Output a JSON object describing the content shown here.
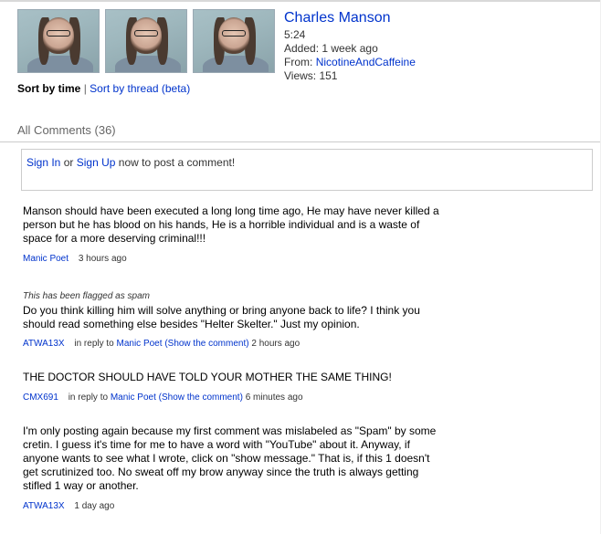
{
  "video": {
    "title": "Charles Manson",
    "duration": "5:24",
    "added": "Added: 1 week ago",
    "from_label": "From:",
    "from_user": "NicotineAndCaffeine",
    "views": "Views: 151",
    "thumbnails": [
      "thumbnail-1",
      "thumbnail-2",
      "thumbnail-3"
    ]
  },
  "sort": {
    "current": "Sort by time",
    "separator": "|",
    "other": "Sort by thread (beta)"
  },
  "comments_header": "All Comments (36)",
  "signin": {
    "sign_in": "Sign In",
    "or": "or",
    "sign_up": "Sign Up",
    "suffix": "now to post a comment!"
  },
  "comments": [
    {
      "flag": "",
      "body": "Manson should have been executed a long long time ago, He may have never killed a person but he has blood on his hands, He is a horrible individual and is a waste of space for a more deserving criminal!!!",
      "author": "Manic Poet",
      "in_reply_to_label": "",
      "in_reply_to_user": "",
      "show_comment": "",
      "time": "3 hours ago"
    },
    {
      "flag": "This has been flagged as spam",
      "body": "Do you think killing him will solve anything or bring anyone back to life? I think you should read something else besides \"Helter Skelter.\" Just my opinion.",
      "author": "ATWA13X",
      "in_reply_to_label": "in reply to",
      "in_reply_to_user": "Manic Poet",
      "show_comment": "(Show the comment)",
      "time": "2 hours ago"
    },
    {
      "flag": "",
      "body": "THE DOCTOR SHOULD HAVE TOLD YOUR MOTHER THE SAME THING!",
      "author": "CMX691",
      "in_reply_to_label": "in reply to",
      "in_reply_to_user": "Manic Poet",
      "show_comment": "(Show the comment)",
      "time": "6 minutes ago"
    },
    {
      "flag": "",
      "body": "I'm only posting again because my first comment was mislabeled as \"Spam\" by some cretin. I guess it's time for me to have a word with \"YouTube\" about it. Anyway, if anyone wants to see what I wrote, click on \"show message.\" That is, if this 1 doesn't get scrutinized too. No sweat off my brow anyway since the truth is always getting stifled 1 way or another.",
      "author": "ATWA13X",
      "in_reply_to_label": "",
      "in_reply_to_user": "",
      "show_comment": "",
      "time": "1 day ago"
    }
  ],
  "colors": {
    "link": "#0033cc",
    "text": "#333333",
    "border": "#cccccc"
  }
}
